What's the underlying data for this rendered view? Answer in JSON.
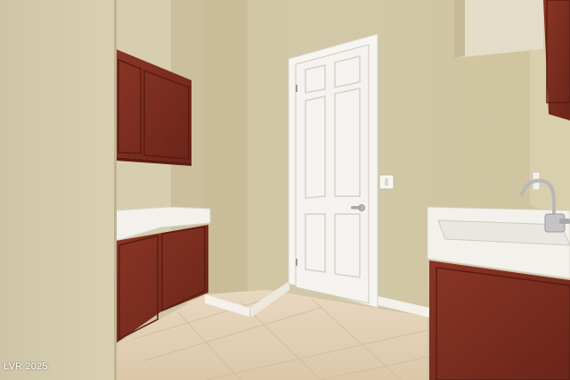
{
  "photo": {
    "scene": "laundry-room",
    "watermark": "LVR 2025"
  },
  "colors": {
    "wall": "#d6ccae",
    "wall_shadow": "#c3b794",
    "cabinet_wood": "#7a2e22",
    "door": "#f4f3ef",
    "counter": "#f2f1ec",
    "floor_tile": "#e3d1b8",
    "baseboard": "#f3f1ea"
  }
}
